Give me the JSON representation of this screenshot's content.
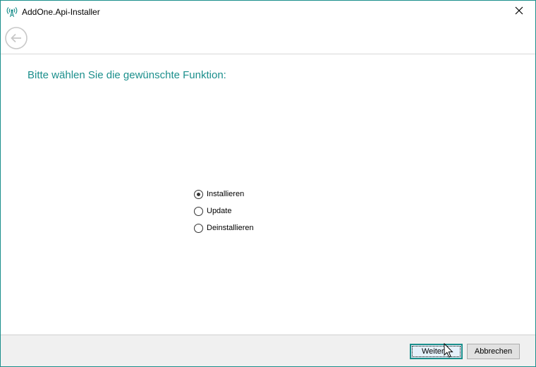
{
  "window": {
    "title": "AddOne.Api-Installer",
    "icons": {
      "app": "antenna-icon",
      "close": "close-icon",
      "back": "back-arrow-icon"
    }
  },
  "main": {
    "heading": "Bitte wählen Sie die gewünschte Funktion:",
    "options": [
      {
        "label": "Installieren",
        "selected": true
      },
      {
        "label": "Update",
        "selected": false
      },
      {
        "label": "Deinstallieren",
        "selected": false
      }
    ]
  },
  "footer": {
    "next_label": "Weiter >",
    "cancel_label": "Abbrechen"
  },
  "colors": {
    "accent": "#1b8f8c",
    "footer_bg": "#f0f0f0"
  }
}
